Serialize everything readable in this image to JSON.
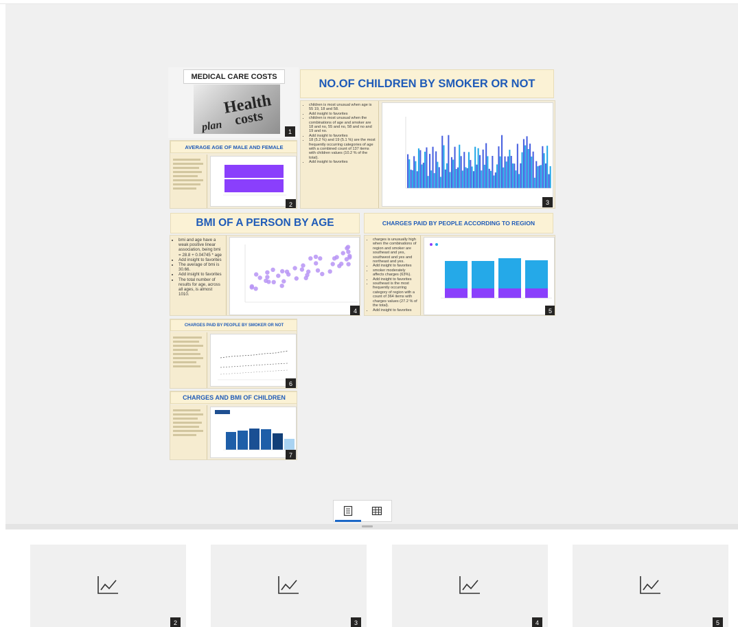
{
  "report": {
    "title_card": "MEDICAL CARE COSTS",
    "image_words": [
      "Health",
      "costs",
      "plan"
    ],
    "headers": {
      "children": "NO.OF CHILDREN BY SMOKER OR NOT",
      "avg_age": "AVERAGE AGE OF MALE AND FEMALE",
      "bmi": "BMI OF A PERSON BY AGE",
      "region": "CHARGES PAID BY PEOPLE ACCORDING TO REGION",
      "smoker": "CHARGES PAID BY PEOPLE BY SMOKER OR NOT",
      "bmi_children": "CHARGES AND BMI OF CHILDREN"
    },
    "notes": {
      "children": [
        "children is most unusual when age is 55 19, 18 and 58.",
        "Add insight to favorites",
        "children is most unusual when the combinations of age and smoker are 18 and no, 55 and no, 58 and no and 19 and no.",
        "Add insight to favorites",
        "18 (5.2 %) and 19 (5.1 %) are the most frequently occurring categories of age with a combined count of 137 items with children values (10.2 % of the total).",
        "Add insight to favorites"
      ],
      "bmi": [
        "bmi and age have a weak positive linear association, being bmi = 28.8 + 0.04745 * age",
        "Add insight to favorites",
        "The average of bmi is 30.66.",
        "Add insight to favorites",
        "The total number of results for age, across all ages, is almost 1010."
      ],
      "region": [
        "charges is unusually high when the combinations of region and smoker are southeast and yes, southwest and yes and northeast and yes.",
        "Add insight to favorites",
        "smoker moderately affects charges (63%).",
        "Add insight to favorites",
        "southeast is the most frequently occurring category of region with a count of 364 items with charges values (27.2 % of the total).",
        "Add insight to favorites"
      ]
    },
    "badges": [
      "1",
      "2",
      "3",
      "4",
      "5",
      "6",
      "7"
    ]
  },
  "view_toggle": {
    "items": [
      {
        "name": "page-view-icon",
        "active": true
      },
      {
        "name": "table-view-icon",
        "active": false
      }
    ]
  },
  "thumbnails": [
    {
      "label": "2",
      "icon": "line-chart-icon"
    },
    {
      "label": "3",
      "icon": "line-chart-icon"
    },
    {
      "label": "4",
      "icon": "line-chart-icon"
    },
    {
      "label": "5",
      "icon": "line-chart-icon"
    }
  ],
  "colors": {
    "accent": "#1c67c7",
    "header_text": "#1f5bb8",
    "header_bg": "#fbf2d5",
    "bar_blue": "#4a62e0",
    "bar_cyan": "#25a9e8",
    "purple": "#8a3ffc",
    "scatter": "#b794f4",
    "badge_bg": "#252423"
  }
}
